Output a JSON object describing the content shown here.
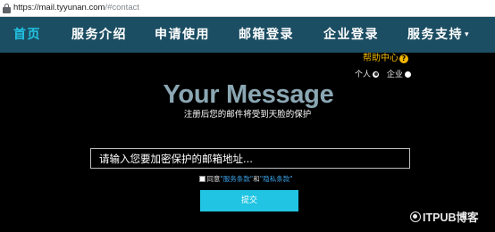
{
  "browser": {
    "url_host": "https://mail.tyyunan.com",
    "url_rest": "/#contact"
  },
  "nav": {
    "items": [
      {
        "label": "首页"
      },
      {
        "label": "服务介绍"
      },
      {
        "label": "申请使用"
      },
      {
        "label": "邮箱登录"
      },
      {
        "label": "企业登录"
      },
      {
        "label": "服务支持"
      }
    ],
    "caret": "▾"
  },
  "help": {
    "label": "帮助中心",
    "icon_glyph": "?"
  },
  "account_type": {
    "options": [
      {
        "label": "个人",
        "checked": true
      },
      {
        "label": "企业",
        "checked": false
      }
    ]
  },
  "main": {
    "title": "Your Message",
    "subtitle": "注册后您的邮件将受到天脸的保护",
    "email_placeholder": "请输入您要加密保护的邮箱地址...",
    "terms": {
      "prefix": "同意",
      "service_link": "\"服务条款\"",
      "and": "和",
      "privacy_link": "\"隐私条款\""
    },
    "submit_label": "提交"
  },
  "watermark": {
    "text": "ITPUB博客"
  },
  "colors": {
    "nav_bg": "#1c4e63",
    "accent": "#21c4e3",
    "title": "#8ba7b3",
    "help": "#f2b600",
    "link": "#3aa0e6"
  }
}
